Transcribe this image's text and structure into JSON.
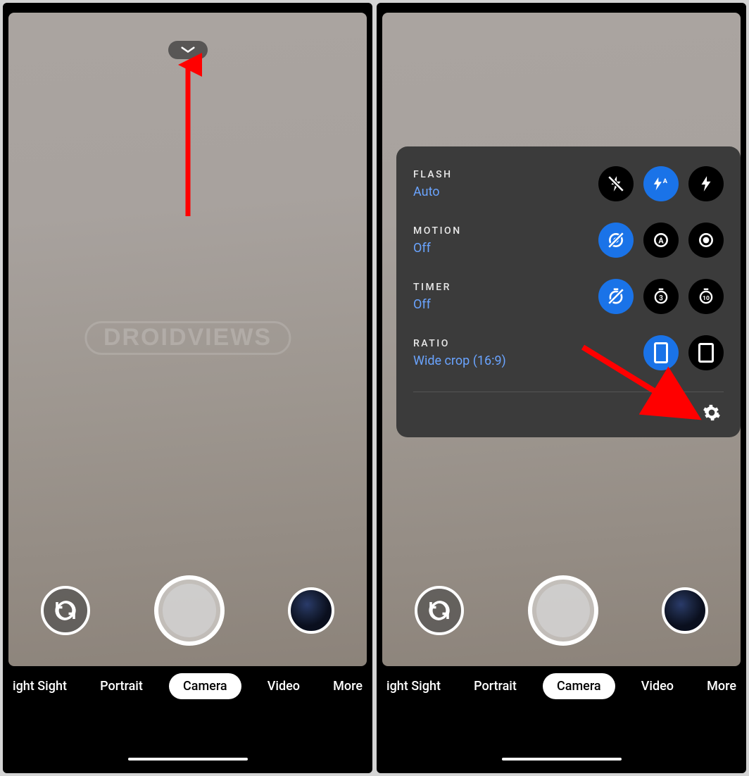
{
  "watermark": "DROIDVIEWS",
  "modes": {
    "items": [
      "ight Sight",
      "Portrait",
      "Camera",
      "Video",
      "More"
    ],
    "active_index": 2
  },
  "panel": {
    "flash": {
      "label": "FLASH",
      "value": "Auto",
      "options": [
        "off",
        "auto",
        "on"
      ],
      "selected": 1
    },
    "motion": {
      "label": "MOTION",
      "value": "Off",
      "options": [
        "off",
        "auto",
        "on"
      ],
      "selected": 0
    },
    "timer": {
      "label": "TIMER",
      "value": "Off",
      "options": [
        "off",
        "3",
        "10"
      ],
      "selected": 0
    },
    "ratio": {
      "label": "RATIO",
      "value": "Wide crop (16:9)",
      "options": [
        "16:9",
        "4:3"
      ],
      "selected": 0
    }
  }
}
